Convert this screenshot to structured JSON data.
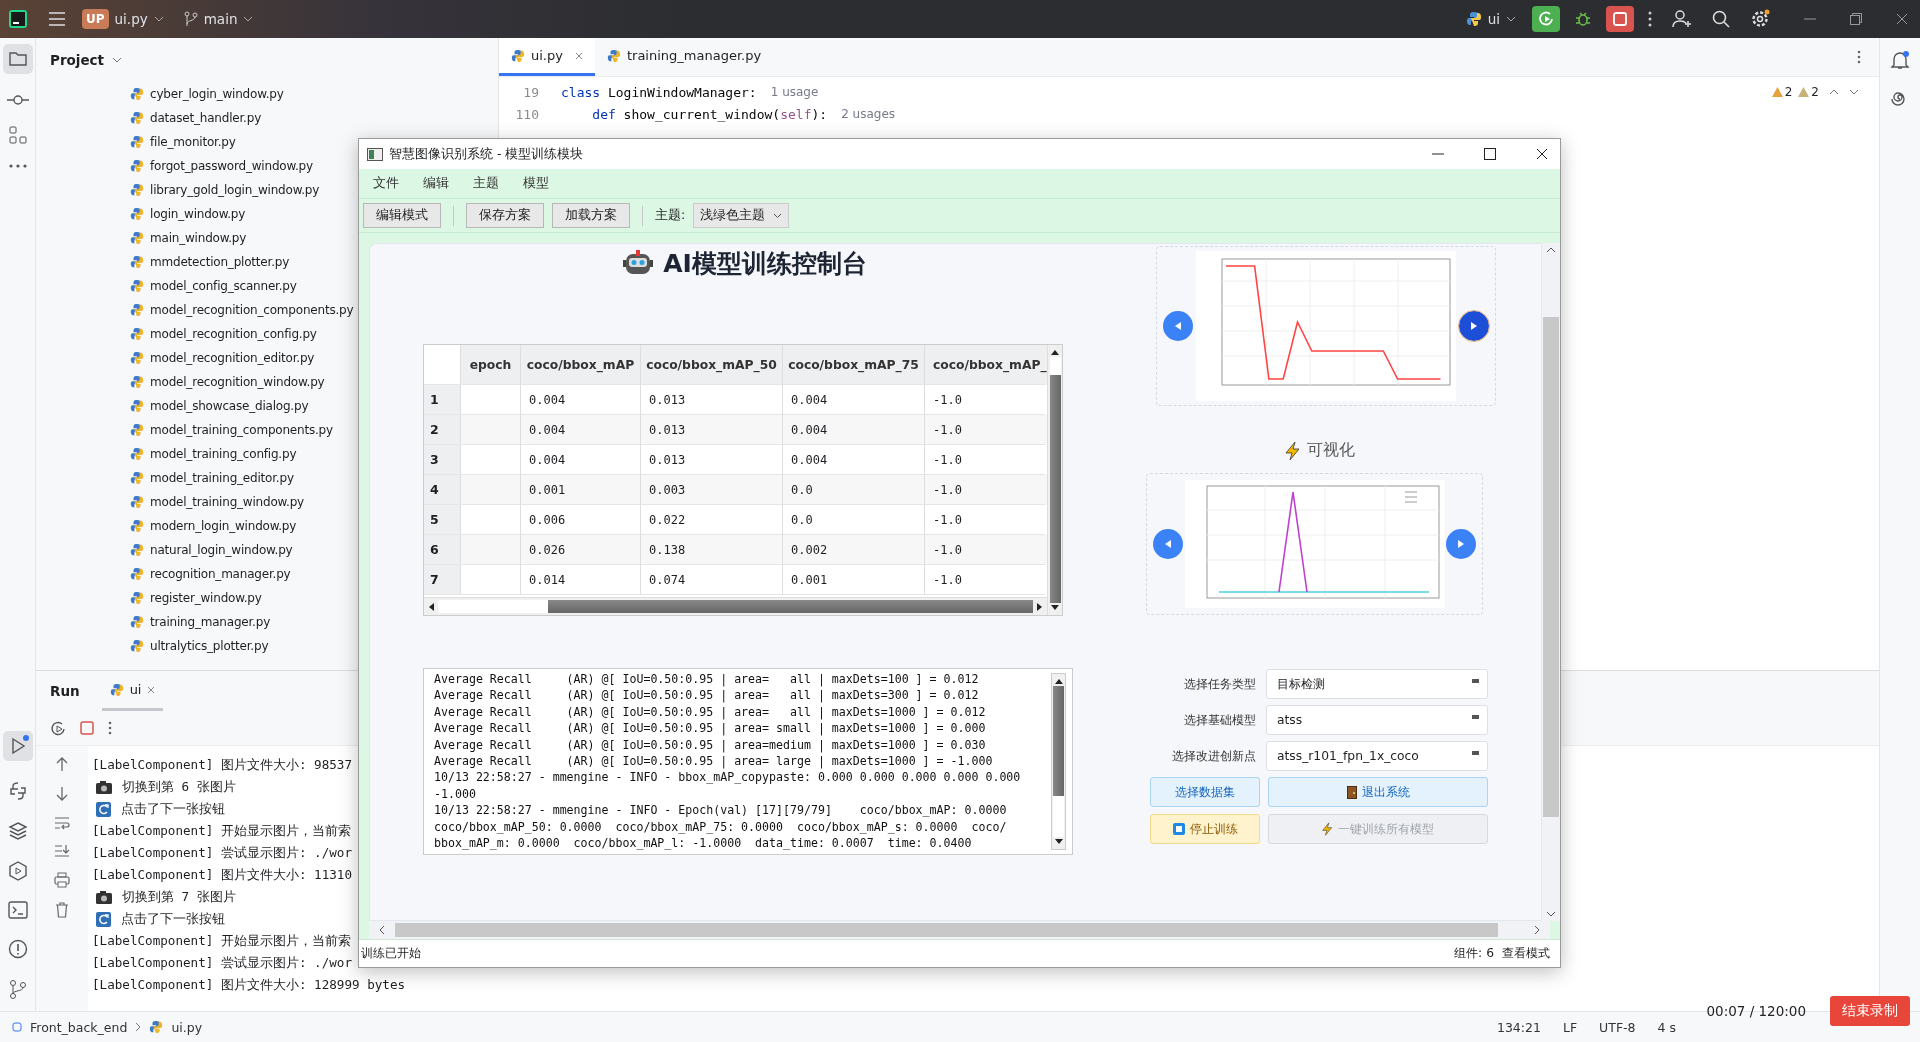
{
  "top_bar": {
    "project_badge": "UP",
    "project": "ui.py",
    "branch": "main",
    "run_config": "ui"
  },
  "project_panel": {
    "title": "Project",
    "files": [
      "cyber_login_window.py",
      "dataset_handler.py",
      "file_monitor.py",
      "forgot_password_window.py",
      "library_gold_login_window.py",
      "login_window.py",
      "main_window.py",
      "mmdetection_plotter.py",
      "model_config_scanner.py",
      "model_recognition_components.py",
      "model_recognition_config.py",
      "model_recognition_editor.py",
      "model_recognition_window.py",
      "model_showcase_dialog.py",
      "model_training_components.py",
      "model_training_config.py",
      "model_training_editor.py",
      "model_training_window.py",
      "modern_login_window.py",
      "natural_login_window.py",
      "recognition_manager.py",
      "register_window.py",
      "training_manager.py",
      "ultralytics_plotter.py"
    ]
  },
  "editor": {
    "tabs": [
      {
        "label": "ui.py",
        "selected": true
      },
      {
        "label": "training_manager.py",
        "selected": false
      }
    ],
    "lines": [
      {
        "number": "19",
        "tokens": [
          {
            "text": "class",
            "kind": "keyword"
          },
          {
            "text": " LoginWindowManager:",
            "kind": "plain"
          }
        ],
        "hint": "1 usage"
      },
      {
        "number": "110",
        "tokens": [
          {
            "text": "    def",
            "kind": "keyword"
          },
          {
            "text": " show_current_window(",
            "kind": "plain"
          },
          {
            "text": "self",
            "kind": "self"
          },
          {
            "text": "):",
            "kind": "plain"
          }
        ],
        "hint": "2 usages"
      }
    ],
    "warnings": [
      {
        "count": "2",
        "kind": "warning"
      },
      {
        "count": "2",
        "kind": "weak"
      }
    ]
  },
  "run_panel": {
    "title": "Run",
    "tab": "ui",
    "lines": [
      {
        "kind": "log",
        "text": "[LabelComponent] 图片文件大小: 98537"
      },
      {
        "kind": "camera",
        "text": "切换到第 6 张图片"
      },
      {
        "kind": "refresh",
        "text": "点击了下一张按钮"
      },
      {
        "kind": "log",
        "text": "[LabelComponent] 开始显示图片，当前索"
      },
      {
        "kind": "log",
        "text": "[LabelComponent] 尝试显示图片: ./wor"
      },
      {
        "kind": "log",
        "text": "[LabelComponent] 图片文件大小: 11310"
      },
      {
        "kind": "camera",
        "text": "切换到第 7 张图片"
      },
      {
        "kind": "refresh",
        "text": "点击了下一张按钮"
      },
      {
        "kind": "log",
        "text": "[LabelComponent] 开始显示图片，当前索"
      },
      {
        "kind": "log",
        "text": "[LabelComponent] 尝试显示图片: ./wor"
      },
      {
        "kind": "log",
        "text": "[LabelComponent] 图片文件大小: 128999 bytes"
      }
    ]
  },
  "status_bar": {
    "breadcrumb": [
      "Front_back_end",
      "ui.py"
    ],
    "items": [
      "134:21",
      "LF",
      "UTF-8",
      "4 s"
    ]
  },
  "recorder": {
    "time": "00:07 / 120:00",
    "button": "结束录制"
  },
  "dialog": {
    "title": "智慧图像识别系统 - 模型训练模块",
    "menu": [
      "文件",
      "编辑",
      "主题",
      "模型"
    ],
    "toolbar": {
      "buttons": [
        "编辑模式",
        "保存方案",
        "加载方案"
      ],
      "theme_label": "主题:",
      "theme_value": "浅绿色主题"
    },
    "heading": "AI模型训练控制台",
    "table": {
      "columns": [
        "epoch",
        "coco/bbox_mAP",
        "coco/bbox_mAP_50",
        "coco/bbox_mAP_75",
        "coco/bbox_mAP_"
      ],
      "rows": [
        {
          "number": "1",
          "cells": [
            "",
            "0.004",
            "0.013",
            "0.004",
            "-1.0"
          ]
        },
        {
          "number": "2",
          "cells": [
            "",
            "0.004",
            "0.013",
            "0.004",
            "-1.0"
          ]
        },
        {
          "number": "3",
          "cells": [
            "",
            "0.004",
            "0.013",
            "0.004",
            "-1.0"
          ]
        },
        {
          "number": "4",
          "cells": [
            "",
            "0.001",
            "0.003",
            "0.0",
            "-1.0"
          ]
        },
        {
          "number": "5",
          "cells": [
            "",
            "0.006",
            "0.022",
            "0.0",
            "-1.0"
          ]
        },
        {
          "number": "6",
          "cells": [
            "",
            "0.026",
            "0.138",
            "0.002",
            "-1.0"
          ]
        },
        {
          "number": "7",
          "cells": [
            "",
            "0.014",
            "0.074",
            "0.001",
            "-1.0"
          ]
        }
      ]
    },
    "log": [
      "Average Recall     (AR) @[ IoU=0.50:0.95 | area=   all | maxDets=100 ] = 0.012",
      "Average Recall     (AR) @[ IoU=0.50:0.95 | area=   all | maxDets=300 ] = 0.012",
      "Average Recall     (AR) @[ IoU=0.50:0.95 | area=   all | maxDets=1000 ] = 0.012",
      "Average Recall     (AR) @[ IoU=0.50:0.95 | area= small | maxDets=1000 ] = 0.000",
      "Average Recall     (AR) @[ IoU=0.50:0.95 | area=medium | maxDets=1000 ] = 0.030",
      "Average Recall     (AR) @[ IoU=0.50:0.95 | area= large | maxDets=1000 ] = -1.000",
      "10/13 22:58:27 - mmengine - INFO - bbox_mAP_copypaste: 0.000 0.000 0.000 0.000 0.000\n-1.000",
      "10/13 22:58:27 - mmengine - INFO - Epoch(val) [17][79/79]    coco/bbox_mAP: 0.0000\ncoco/bbox_mAP_50: 0.0000  coco/bbox_mAP_75: 0.0000  coco/bbox_mAP_s: 0.0000  coco/\nbbox_mAP_m: 0.0000  coco/bbox_mAP_l: -1.0000  data_time: 0.0007  time: 0.0400"
    ],
    "visualization_title": "可视化",
    "form": [
      {
        "label": "选择任务类型",
        "value": "目标检测"
      },
      {
        "label": "选择基础模型",
        "value": "atss"
      },
      {
        "label": "选择改进创新点",
        "value": "atss_r101_fpn_1x_coco"
      }
    ],
    "buttons": [
      {
        "label": "选择数据集",
        "kind": "dataset",
        "disabled": false
      },
      {
        "label": "退出系统",
        "kind": "exit",
        "disabled": false
      },
      {
        "label": "停止训练",
        "kind": "stop",
        "disabled": false
      },
      {
        "label": "一键训练所有模型",
        "kind": "train_all",
        "disabled": true
      }
    ],
    "status": {
      "message": "训练已开始",
      "components": "组件: 6",
      "mode": "查看模式"
    }
  }
}
